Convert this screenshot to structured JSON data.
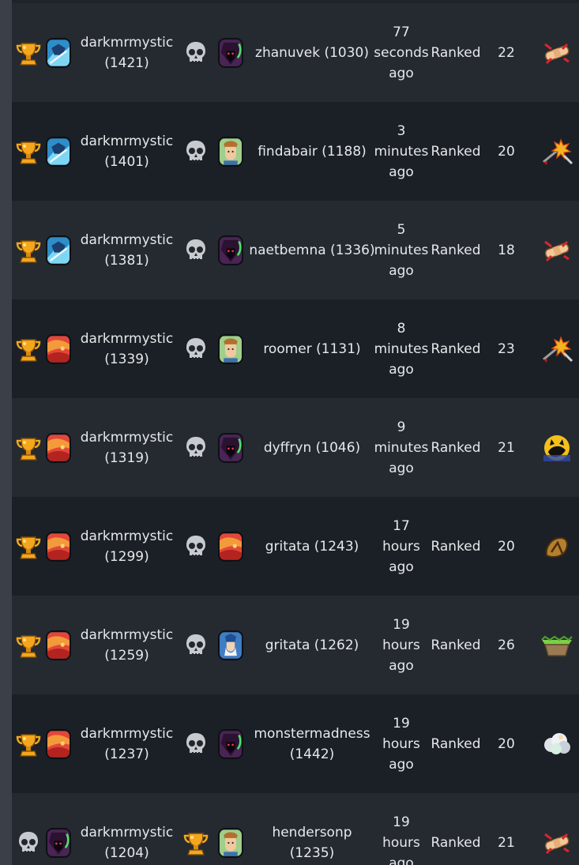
{
  "matches": [
    {
      "result": "win",
      "legend1": "blue-hero",
      "player1_name": "darkmrmystic",
      "player1_elo": "(1421)",
      "opp_result": "loss",
      "legend2": "dark-mage",
      "player2": "zhanuvek (1030)",
      "time": [
        "77",
        "seconds",
        "ago"
      ],
      "mode": "Ranked",
      "number": "22",
      "weapon": "bandage-icon"
    },
    {
      "result": "win",
      "legend1": "blue-hero",
      "player1_name": "darkmrmystic",
      "player1_elo": "(1401)",
      "opp_result": "loss",
      "legend2": "brown-hair",
      "player2": "findabair (1188)",
      "time": [
        "3",
        "minutes",
        "ago"
      ],
      "mode": "Ranked",
      "number": "20",
      "weapon": "explosion-arrow-icon"
    },
    {
      "result": "win",
      "legend1": "blue-hero",
      "player1_name": "darkmrmystic",
      "player1_elo": "(1381)",
      "opp_result": "loss",
      "legend2": "dark-mage",
      "player2": "naetbemna (1336)",
      "time": [
        "5",
        "minutes",
        "ago"
      ],
      "mode": "Ranked",
      "number": "18",
      "weapon": "bandage-icon"
    },
    {
      "result": "win",
      "legend1": "red-beast",
      "player1_name": "darkmrmystic",
      "player1_elo": "(1339)",
      "opp_result": "loss",
      "legend2": "brown-hair",
      "player2": "roomer (1131)",
      "time": [
        "8",
        "minutes",
        "ago"
      ],
      "mode": "Ranked",
      "number": "23",
      "weapon": "explosion-arrow-icon"
    },
    {
      "result": "win",
      "legend1": "red-beast",
      "player1_name": "darkmrmystic",
      "player1_elo": "(1319)",
      "opp_result": "loss",
      "legend2": "dark-mage",
      "player2": "dyffryn (1046)",
      "time": [
        "9",
        "minutes",
        "ago"
      ],
      "mode": "Ranked",
      "number": "21",
      "weapon": "shadow-moon-icon"
    },
    {
      "result": "win",
      "legend1": "red-beast",
      "player1_name": "darkmrmystic",
      "player1_elo": "(1299)",
      "opp_result": "loss",
      "legend2": "red-beast",
      "player2": "gritata (1243)",
      "time": [
        "17",
        "hours",
        "ago"
      ],
      "mode": "Ranked",
      "number": "20",
      "weapon": "rock-fist-icon"
    },
    {
      "result": "win",
      "legend1": "red-beast",
      "player1_name": "darkmrmystic",
      "player1_elo": "(1259)",
      "opp_result": "loss",
      "legend2": "wizard",
      "player2": "gritata (1262)",
      "time": [
        "19",
        "hours",
        "ago"
      ],
      "mode": "Ranked",
      "number": "26",
      "weapon": "grass-platform-icon"
    },
    {
      "result": "win",
      "legend1": "red-beast",
      "player1_name": "darkmrmystic",
      "player1_elo": "(1237)",
      "opp_result": "loss",
      "legend2": "dark-mage",
      "player2": "monstermadness (1442)",
      "time": [
        "19",
        "hours",
        "ago"
      ],
      "mode": "Ranked",
      "number": "20",
      "weapon": "smoke-cloud-icon"
    },
    {
      "result": "loss",
      "legend1": "dark-mage",
      "player1_name": "darkmrmystic",
      "player1_elo": "(1204)",
      "opp_result": "win",
      "legend2": "brown-hair",
      "player2": "hendersonp (1235)",
      "time": [
        "19",
        "hours",
        "ago"
      ],
      "mode": "Ranked",
      "number": "21",
      "weapon": "bandage-icon"
    }
  ],
  "colors": {
    "row_dark": "#1b2026",
    "row_light": "#252a31",
    "trophy": "#f0a020",
    "skull": "#bfc3c7"
  }
}
